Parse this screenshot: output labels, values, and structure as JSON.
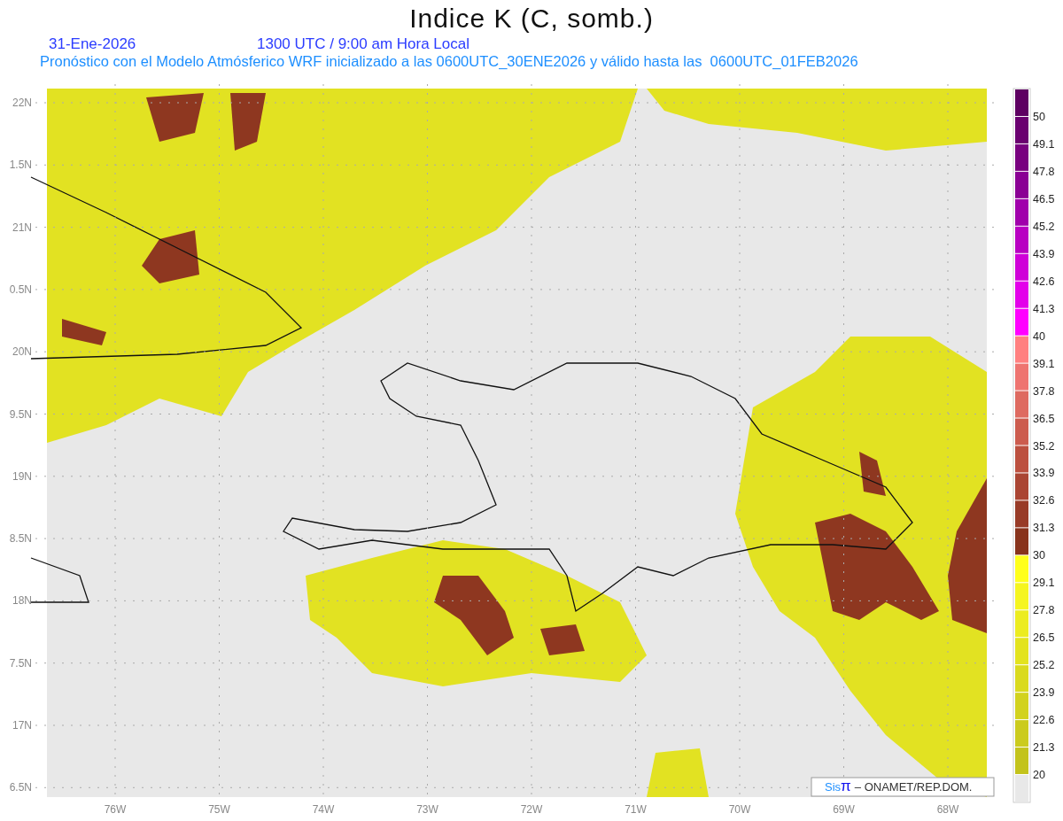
{
  "title": "Indice K (C, somb.)",
  "date": "31-Ene-2026",
  "time_line": "1300 UTC / 9:00 am Hora Local",
  "subtitle": "Pronóstico con el Modelo Atmósferico WRF inicializado a las 0600UTC_30ENE2026 y válido hasta las  0600UTC_01FEB2026",
  "map": {
    "y_ticks": [
      "22N",
      "1.5N",
      "21N",
      "0.5N",
      "20N",
      "9.5N",
      "19N",
      "8.5N",
      "18N",
      "7.5N",
      "17N",
      "6.5N"
    ],
    "x_ticks": [
      "76W",
      "75W",
      "74W",
      "73W",
      "72W",
      "71W",
      "70W",
      "69W",
      "68W"
    ]
  },
  "colorbar": [
    {
      "color": "#5e0062",
      "label": "50"
    },
    {
      "color": "#6a0070",
      "label": "49.1"
    },
    {
      "color": "#78007f",
      "label": "47.8"
    },
    {
      "color": "#8a0094",
      "label": "46.5"
    },
    {
      "color": "#a000ab",
      "label": "45.2"
    },
    {
      "color": "#b800c2",
      "label": "43.9"
    },
    {
      "color": "#cf00d8",
      "label": "42.6"
    },
    {
      "color": "#e300ea",
      "label": "41.3"
    },
    {
      "color": "#ff00ff",
      "label": "40"
    },
    {
      "color": "#ff8080",
      "label": "39.1"
    },
    {
      "color": "#ee7470",
      "label": "37.8"
    },
    {
      "color": "#de6a60",
      "label": "36.5"
    },
    {
      "color": "#cc5c4e",
      "label": "35.2"
    },
    {
      "color": "#bc503f",
      "label": "33.9"
    },
    {
      "color": "#aa4533",
      "label": "32.6"
    },
    {
      "color": "#983b27",
      "label": "31.3"
    },
    {
      "color": "#88331c",
      "label": "30"
    },
    {
      "color": "#ffff1c",
      "label": "29.1"
    },
    {
      "color": "#f5f520",
      "label": "27.8"
    },
    {
      "color": "#ecec20",
      "label": "26.5"
    },
    {
      "color": "#e3e31e",
      "label": "25.2"
    },
    {
      "color": "#dada1e",
      "label": "23.9"
    },
    {
      "color": "#d2d21e",
      "label": "22.6"
    },
    {
      "color": "#cbcb1e",
      "label": "21.3"
    },
    {
      "color": "#c3c31c",
      "label": "20"
    },
    {
      "color": "#e8e8e8"
    }
  ],
  "credit": {
    "logo": "Sis",
    "logo_symbol": "π",
    "text": "–  ONAMET/REP.DOM."
  }
}
